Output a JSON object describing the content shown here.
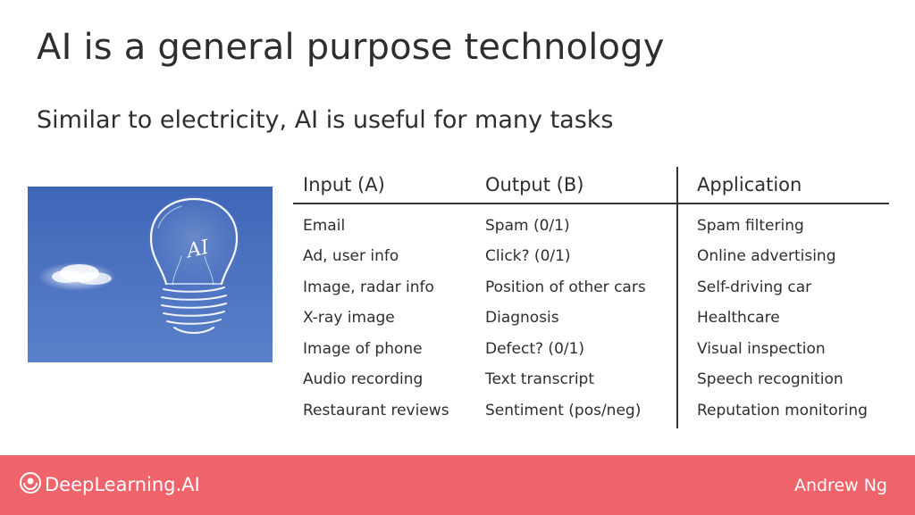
{
  "slide": {
    "title": "AI is a general purpose technology",
    "subtitle": "Similar to electricity, AI is useful for many tasks",
    "image_text": "AI"
  },
  "table": {
    "headers": [
      "Input (A)",
      "Output (B)",
      "Application"
    ],
    "rows": [
      [
        "Email",
        "Spam (0/1)",
        "Spam filtering"
      ],
      [
        "Ad, user info",
        "Click? (0/1)",
        "Online advertising"
      ],
      [
        "Image, radar info",
        "Position of other cars",
        "Self-driving car"
      ],
      [
        "X-ray image",
        "Diagnosis",
        "Healthcare"
      ],
      [
        "Image of phone",
        "Defect? (0/1)",
        "Visual inspection"
      ],
      [
        "Audio recording",
        "Text transcript",
        "Speech recognition"
      ],
      [
        "Restaurant reviews",
        "Sentiment (pos/neg)",
        "Reputation monitoring"
      ]
    ]
  },
  "footer": {
    "logo_text": "DeepLearning.AI",
    "logo_icon": "deeplearning-logo-icon",
    "author": "Andrew Ng",
    "background_color": "#ef636b"
  },
  "photo": {
    "sky_color": "#4a71c0",
    "icons": [
      "lightbulb-icon",
      "cloud-icon"
    ]
  }
}
